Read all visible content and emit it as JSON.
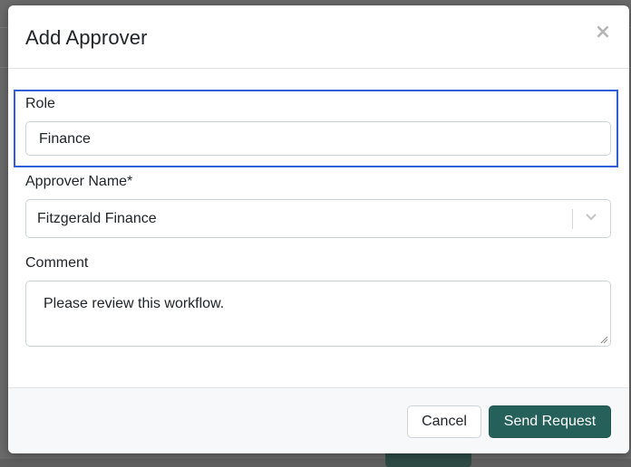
{
  "modal": {
    "title": "Add Approver",
    "close_glyph": "×",
    "close_icon": "close-icon"
  },
  "form": {
    "role": {
      "label": "Role",
      "value": "Finance"
    },
    "approver": {
      "label": "Approver Name*",
      "value": "Fitzgerald Finance",
      "icon": "chevron-down-icon"
    },
    "comment": {
      "label": "Comment",
      "value": "Please review this workflow."
    }
  },
  "footer": {
    "cancel_label": "Cancel",
    "send_label": "Send Request"
  },
  "colors": {
    "primary": "#25615a",
    "focus": "#2f5ed8"
  }
}
